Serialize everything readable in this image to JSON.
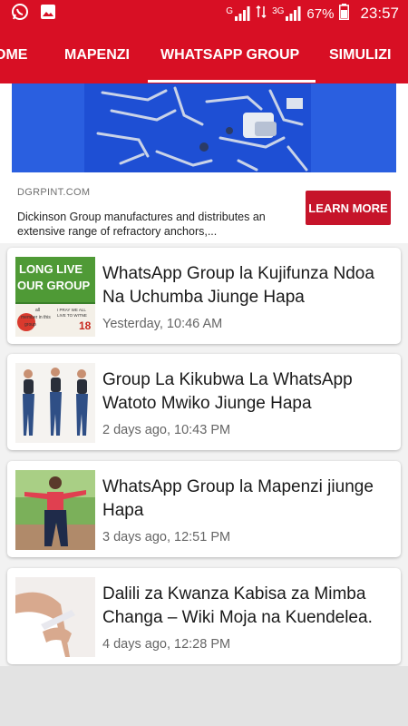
{
  "status_bar": {
    "signal_1": "G",
    "signal_2": "3G",
    "battery_percent": "67%",
    "time": "23:57",
    "icons": [
      "whatsapp-icon",
      "gallery-icon",
      "signal-icon",
      "data-arrows-icon",
      "battery-icon"
    ]
  },
  "nav": {
    "tabs": [
      {
        "label": "OME"
      },
      {
        "label": "MAPENZI"
      },
      {
        "label": "WHATSAPP GROUP"
      },
      {
        "label": "SIMULIZI"
      }
    ],
    "active_tab": "WHATSAPP GROUP"
  },
  "ad": {
    "domain": "DGRPINT.COM",
    "description": "Dickinson Group manufactures and distributes an extensive range of refractory anchors,...",
    "cta": "LEARN MORE"
  },
  "posts": [
    {
      "title": "WhatsApp Group la Kujifunza Ndoa Na Uchumba Jiunge Hapa",
      "time": "Yesterday, 10:46 AM",
      "thumb_text": {
        "line1": "LONG LIVE",
        "line2": "OUR GROUP",
        "small1": "all",
        "small2": "member in this",
        "small3": "group",
        "pray1": "I PRAY WE ALL",
        "pray2": "LIVE TO WITNE",
        "pray3": "18"
      }
    },
    {
      "title": "Group La Kikubwa La WhatsApp Watoto Mwiko Jiunge Hapa",
      "time": "2 days ago, 10:43 PM"
    },
    {
      "title": "WhatsApp Group la Mapenzi jiunge Hapa",
      "time": "3 days ago, 12:51 PM"
    },
    {
      "title": "Dalili za Kwanza Kabisa za Mimba Changa – Wiki Moja na Kuendelea.",
      "time": "4 days ago, 12:28 PM"
    }
  ],
  "colors": {
    "brand_red": "#d80f24",
    "cta_red": "#c6142a",
    "ad_blue": "#1e4fd4"
  }
}
